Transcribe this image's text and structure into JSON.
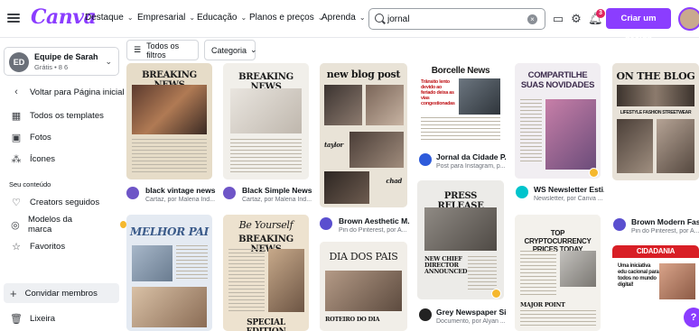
{
  "brand": {
    "logo": "Canva",
    "accent": "#8b3dff"
  },
  "nav": [
    {
      "label": "Destaque"
    },
    {
      "label": "Empresarial"
    },
    {
      "label": "Educação"
    },
    {
      "label": "Planos e preços"
    },
    {
      "label": "Aprenda"
    }
  ],
  "search": {
    "value": "jornal"
  },
  "notifications": {
    "count": "3"
  },
  "create_button": "Criar um design",
  "team": {
    "initials": "ED",
    "name": "Equipe de Sarah",
    "plan": "Grátis • 8 6"
  },
  "sidebar": {
    "back": "Voltar para Página inicial",
    "items": [
      "Todos os templates",
      "Fotos",
      "Ícones"
    ],
    "section_label": "Seu conteúdo",
    "content_items": [
      "Creators seguidos",
      "Modelos da marca",
      "Favoritos"
    ],
    "invite": "Convidar membros",
    "trash": "Lixeira"
  },
  "filters": {
    "all": "Todos os filtros",
    "category": "Categoria"
  },
  "templates": {
    "c1": {
      "head": "BREAKING NEWS",
      "title": "black vintage news...",
      "meta": "Cartaz, por Malena Ind..."
    },
    "c2": {
      "head": "BREAKING NEWS",
      "title": "Black Simple News...",
      "meta": "Cartaz, por Malena Ind..."
    },
    "c3": {
      "head": "new blog post",
      "names": [
        "taylor",
        "chad"
      ],
      "title": "Brown Aesthetic M...",
      "meta": "Pin do Pinterest, por A..."
    },
    "c4": {
      "head": "Borcelle News",
      "sub": "Trânsito lento devido ao feriado deixa as vias congestionadas",
      "title": "Jornal da Cidade P...",
      "meta": "Post para Instagram, p..."
    },
    "c5": {
      "head": "COMPARTILHE SUAS NOVIDADES",
      "title": "WS Newsletter Esti...",
      "meta": "Newsletter, por Canva ..."
    },
    "c6": {
      "head": "ON THE BLOG",
      "sub": "LIFESTYLE  FASHION  STREETWEAR",
      "title": "Brown Modern Fas...",
      "meta": "Pin do Pinterest, por A..."
    },
    "c7": {
      "head": "MELHOR PAI"
    },
    "c8": {
      "head": "BREAKING NEWS",
      "script": "Be Yourself",
      "foot": "SPECIAL EDITION"
    },
    "c9": {
      "head": "DIA DOS PAIS",
      "foot": "ROTEIRO DO DIA"
    },
    "c10": {
      "head": "PRESS RELEASE",
      "sub": "NEW CHIEF DIRECTOR ANNOUNCED",
      "title": "Grey Newspaper Si...",
      "meta": "Documento, por Alyan ..."
    },
    "c11": {
      "head": "TOP CRYPTOCURRENCY PRICES TODAY",
      "foot": "MAJOR POINT"
    },
    "c12": {
      "head": "CIDADANIA",
      "sub": "Uma iniciativa edu cacional para todos no mundo digital!"
    }
  },
  "help": "?"
}
